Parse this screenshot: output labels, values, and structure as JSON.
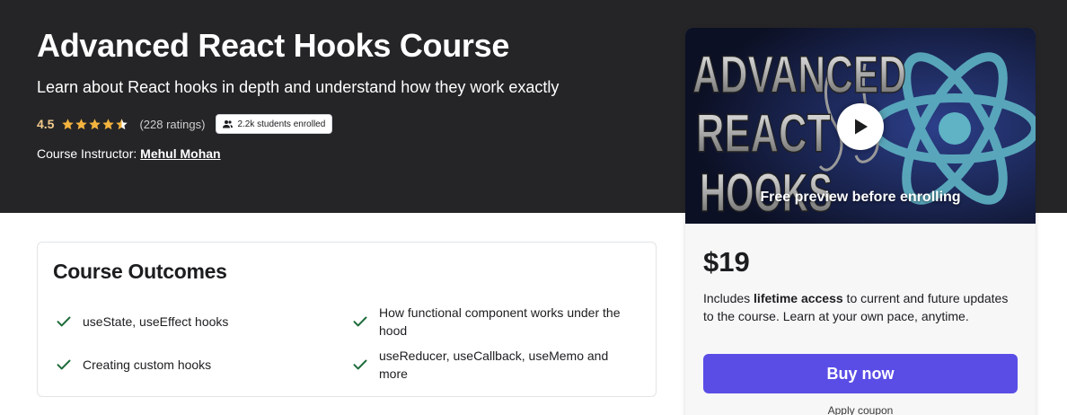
{
  "course": {
    "title": "Advanced React Hooks Course",
    "subtitle": "Learn about React hooks in depth and understand how they work exactly",
    "rating_value": "4.5",
    "ratings_count": "(228 ratings)",
    "enrolled": "2.2k students enrolled",
    "instructor_prefix": "Course Instructor: ",
    "instructor_name": "Mehul Mohan"
  },
  "outcomes": {
    "title": "Course Outcomes",
    "items": [
      "useState, useEffect hooks",
      "How functional component works under the hood",
      "Creating custom hooks",
      "useReducer, useCallback, useMemo and more"
    ]
  },
  "card": {
    "thumbnail_text": [
      "ADVANCED",
      "REACT",
      "HOOKS"
    ],
    "preview_label": "Free preview before enrolling",
    "price": "$19",
    "includes_pre": "Includes ",
    "includes_bold": "lifetime access",
    "includes_post": " to current and future updates to the course. Learn at your own pace, anytime.",
    "buy_label": "Buy now",
    "coupon_label": "Apply coupon"
  },
  "icons": {
    "star": "star-icon",
    "users": "users-icon",
    "check": "check-icon",
    "play": "play-icon"
  },
  "colors": {
    "hero_bg": "#252527",
    "rating": "#f3ca8c",
    "star": "#f4b33e",
    "check": "#1e6c3b",
    "buy": "#5a4de6"
  }
}
